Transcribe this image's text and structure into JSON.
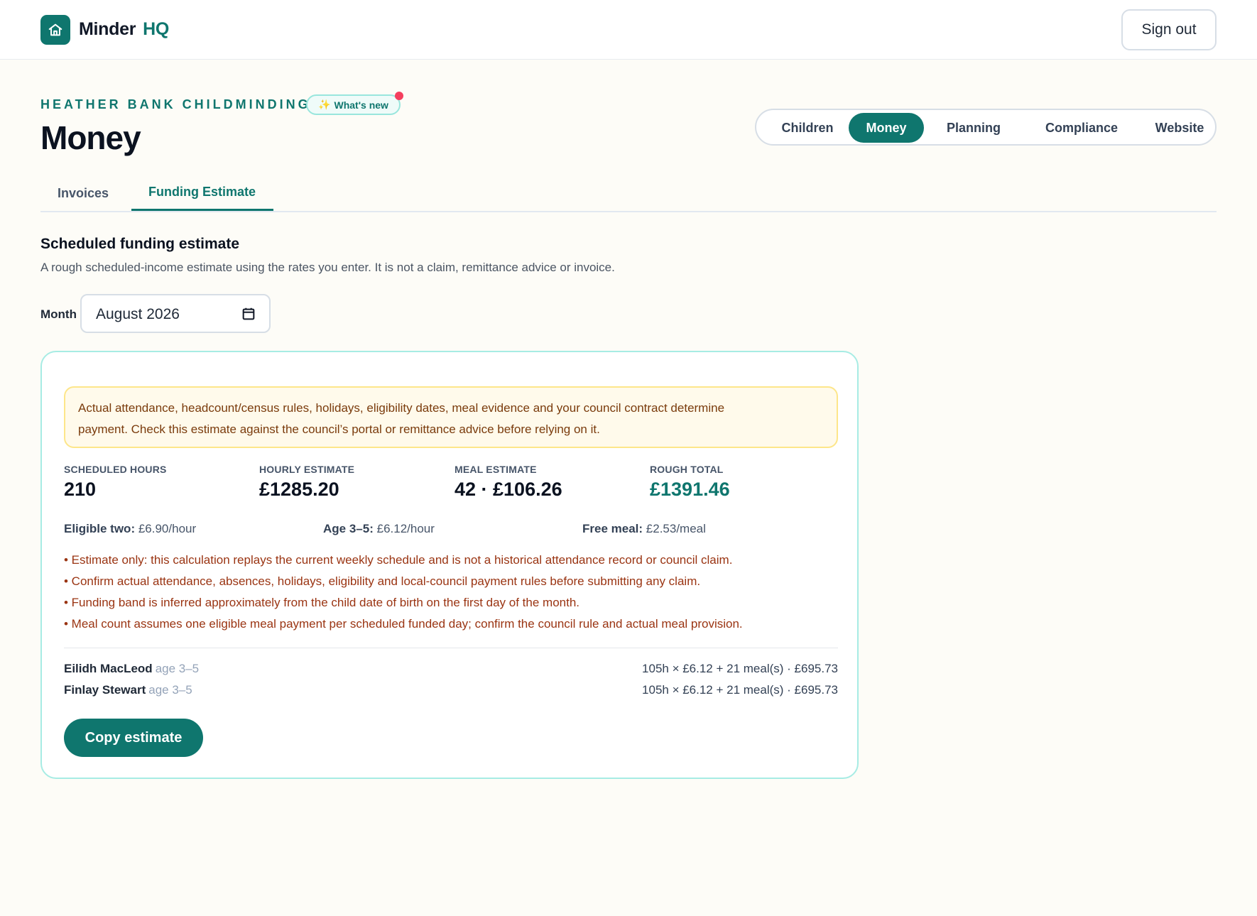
{
  "brand": {
    "name": "Minder",
    "suffix": "HQ",
    "logo_icon": "home-icon"
  },
  "header": {
    "sign_out_label": "Sign out"
  },
  "page": {
    "org_name": "HEATHER BANK CHILDMINDING",
    "whats_new_label": "What's new",
    "whats_new_icon": "sparkles-icon",
    "title": "Money"
  },
  "nav": {
    "items": [
      {
        "label": "Children"
      },
      {
        "label": "Money",
        "active": true
      },
      {
        "label": "Planning"
      },
      {
        "label": "Compliance"
      },
      {
        "label": "Website"
      }
    ]
  },
  "tabs": [
    {
      "label": "Invoices"
    },
    {
      "label": "Funding Estimate",
      "active": true
    }
  ],
  "section": {
    "title": "Scheduled funding estimate",
    "description": "A rough scheduled-income estimate using the rates you enter. It is not a claim, remittance advice or invoice."
  },
  "month": {
    "label": "Month",
    "value": "August 2026",
    "icon": "calendar-icon"
  },
  "card": {
    "warning_line1": "Actual attendance, headcount/census rules, holidays, eligibility dates, meal evidence and your council contract determine",
    "warning_line2": "payment. Check this estimate against the council’s portal or remittance advice before relying on it.",
    "stats": [
      {
        "label": "SCHEDULED HOURS",
        "value": "210"
      },
      {
        "label": "HOURLY ESTIMATE",
        "value": "£1285.20"
      },
      {
        "label": "MEAL ESTIMATE",
        "value": "42 · £106.26"
      },
      {
        "label": "ROUGH TOTAL",
        "value": "£1391.46"
      }
    ],
    "rates": [
      {
        "label": "Eligible two:",
        "value": "£6.90/hour"
      },
      {
        "label": "Age 3–5:",
        "value": "£6.12/hour"
      },
      {
        "label": "Free meal:",
        "value": "£2.53/meal"
      }
    ],
    "notes": [
      "• Estimate only: this calculation replays the current weekly schedule and is not a historical attendance record or council claim.",
      "• Confirm actual attendance, absences, holidays, eligibility and local-council payment rules before submitting any claim.",
      "• Funding band is inferred approximately from the child date of birth on the first day of the month.",
      "• Meal count assumes one eligible meal payment per scheduled funded day; confirm the council rule and actual meal provision."
    ],
    "children": [
      {
        "name": "Eilidh MacLeod",
        "age": "age 3–5",
        "calc": "105h × £6.12 + 21 meal(s) · £695.73"
      },
      {
        "name": "Finlay Stewart",
        "age": "age 3–5",
        "calc": "105h × £6.12 + 21 meal(s) · £695.73"
      }
    ],
    "copy_label": "Copy estimate"
  },
  "colors": {
    "accent": "#0f766e",
    "warning_bg": "#fffaeb",
    "warning_text": "#7a3b0c",
    "notes_text": "#9a3412",
    "badge_dot": "#f43f5e"
  }
}
